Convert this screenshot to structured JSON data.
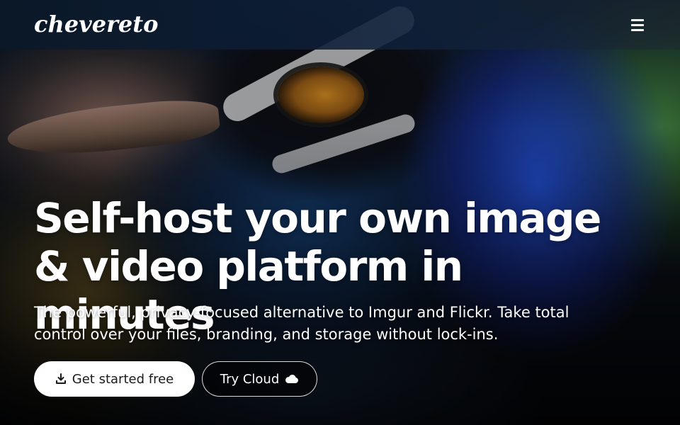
{
  "header": {
    "logo_text": "chevereto",
    "menu_icon": "hamburger-menu-icon"
  },
  "hero": {
    "headline": "Self-host your own image & video platform in minutes",
    "subtitle": "The powerful, privacy-focused alternative to Imgur and Flickr. Take total control over your files, branding, and storage without lock-ins.",
    "primary_button": {
      "label": "Get started free",
      "icon": "download-icon"
    },
    "secondary_button": {
      "label": "Try Cloud",
      "icon": "cloud-icon"
    }
  },
  "colors": {
    "header_bg": "#0e203a",
    "primary_button_bg": "#ffffff",
    "primary_button_text": "#1a1a1a",
    "text": "#ffffff"
  }
}
